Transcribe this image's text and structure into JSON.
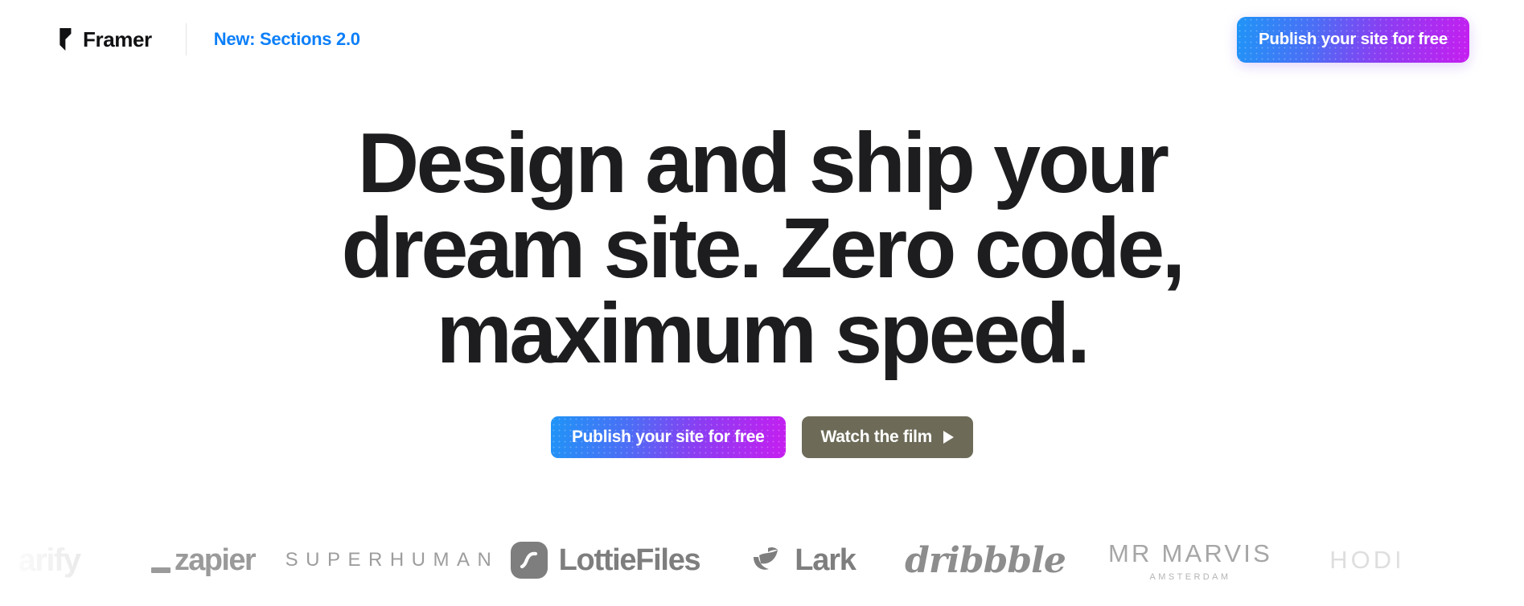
{
  "nav": {
    "brand_name": "Framer",
    "brand_icon": "framer-logo-icon",
    "announcement_link": "New: Sections 2.0",
    "cta_label": "Publish your site for free"
  },
  "hero": {
    "headline_lines": [
      "Design and ship your",
      "dream site. Zero code,",
      "maximum speed."
    ],
    "primary_cta": "Publish your site for free",
    "secondary_cta": "Watch the film",
    "secondary_cta_icon": "play-triangle-icon"
  },
  "logos": [
    {
      "name": "clarify",
      "text": "arify",
      "sub": ""
    },
    {
      "name": "zapier",
      "text": "zapier",
      "sub": ""
    },
    {
      "name": "superhuman",
      "text": "SUPERHUMAN",
      "sub": ""
    },
    {
      "name": "lottiefiles",
      "text": "LottieFiles",
      "sub": ""
    },
    {
      "name": "lark",
      "text": "Lark",
      "sub": ""
    },
    {
      "name": "dribbble",
      "text": "dribbble",
      "sub": ""
    },
    {
      "name": "mr-marvis",
      "text": "MR MARVIS",
      "sub": "AMSTERDAM"
    },
    {
      "name": "hodi",
      "text": "HODI",
      "sub": ""
    }
  ],
  "colors": {
    "accent_blue": "#0c7ff9",
    "gradient_start": "#1f95f7",
    "gradient_end": "#c61ef0",
    "headline": "#1d1d1f",
    "film_button": "#6d6b58",
    "logo_gray": "#8e8e8e",
    "background": "#ffffff"
  }
}
